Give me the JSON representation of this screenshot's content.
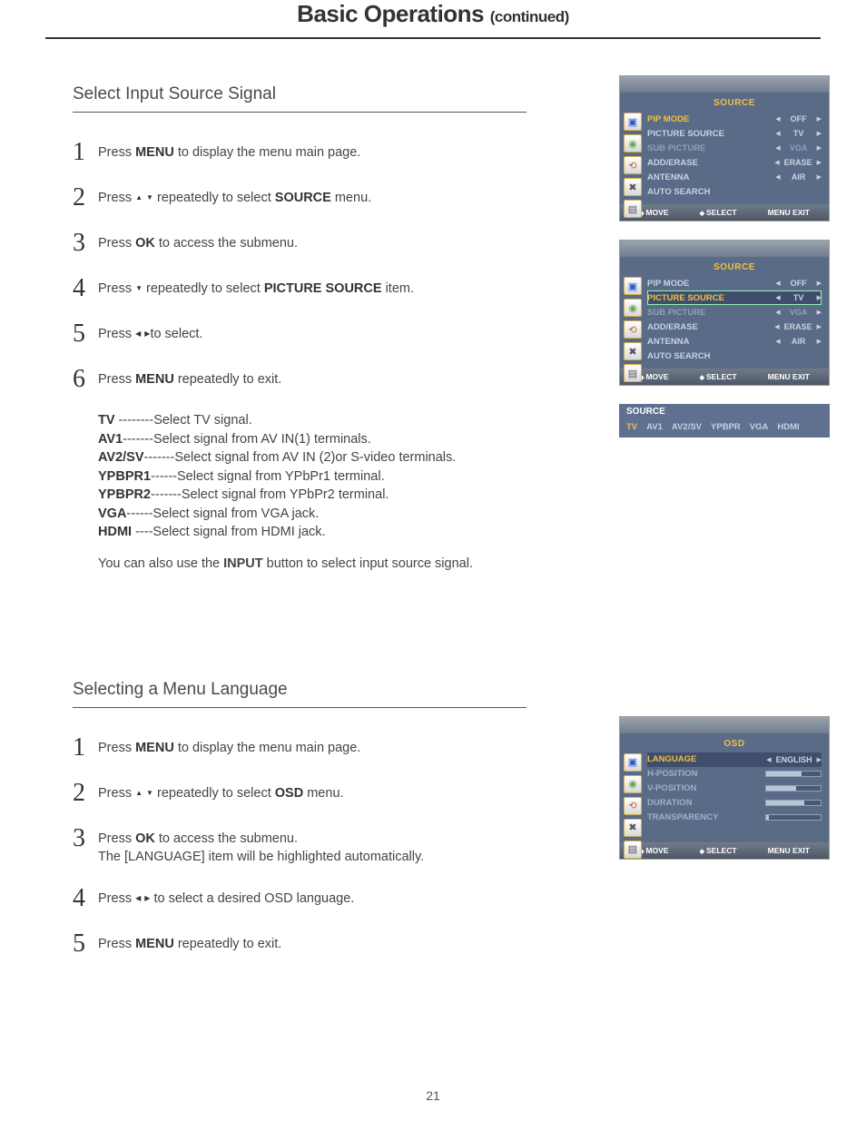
{
  "page_title": "Basic Operations",
  "page_title_cont": "(continued)",
  "page_number": "21",
  "section1": {
    "title": "Select Input Source Signal",
    "steps": [
      {
        "n": "1",
        "pre": "Press ",
        "b": "MENU",
        "post": " to display the menu main page."
      },
      {
        "n": "2",
        "pre": "Press ",
        "arrows": "ud",
        "mid": " repeatedly to select ",
        "b": "SOURCE",
        "post": " menu."
      },
      {
        "n": "3",
        "pre": "Press ",
        "b": "OK",
        "post": " to access the submenu."
      },
      {
        "n": "4",
        "pre": "Press ",
        "arrows": "d",
        "mid": " repeatedly to select ",
        "b": "PICTURE SOURCE",
        "post": " item."
      },
      {
        "n": "5",
        "pre": "Press ",
        "arrows": "lr",
        "post": "to select."
      },
      {
        "n": "6",
        "pre": "Press ",
        "b": "MENU",
        "post": " repeatedly to exit."
      }
    ],
    "signals": [
      {
        "key": "TV",
        "dash": " --------",
        "desc": "Select TV signal."
      },
      {
        "key": "AV1",
        "dash": "-------",
        "desc": "Select signal from AV IN(1) terminals."
      },
      {
        "key": "AV2/SV",
        "dash": "-------",
        "desc": "Select signal from AV IN (2)or S-video terminals."
      },
      {
        "key": "YPBPR1",
        "dash": "------",
        "desc": "Select signal from YPbPr1 terminal."
      },
      {
        "key": "YPBPR2",
        "dash": "-------",
        "desc": "Select signal from YPbPr2 terminal."
      },
      {
        "key": "VGA",
        "dash": "------",
        "desc": "Select signal from VGA jack."
      },
      {
        "key": "HDMI",
        "dash": " ----",
        "desc": "Select signal from HDMI jack."
      }
    ],
    "final_note_pre": "You can also use the ",
    "final_note_b": "INPUT",
    "final_note_post": " button to select input source signal."
  },
  "osd1": {
    "title": "SOURCE",
    "rows": [
      {
        "label": "PIP MODE",
        "val": "OFF",
        "hl": true
      },
      {
        "label": "PICTURE SOURCE",
        "val": "TV"
      },
      {
        "label": "SUB PICTURE",
        "val": "VGA",
        "dim": true
      },
      {
        "label": "ADD/ERASE",
        "val": "ERASE"
      },
      {
        "label": "ANTENNA",
        "val": "AIR"
      },
      {
        "label": "AUTO SEARCH",
        "val": ""
      }
    ],
    "footer": {
      "move": "MOVE",
      "select": "SELECT",
      "exit": "MENU  EXIT"
    }
  },
  "osd2": {
    "title": "SOURCE",
    "rows": [
      {
        "label": "PIP MODE",
        "val": "OFF"
      },
      {
        "label": "PICTURE SOURCE",
        "val": "TV",
        "sel": true
      },
      {
        "label": "SUB PICTURE",
        "val": "VGA",
        "dim": true
      },
      {
        "label": "ADD/ERASE",
        "val": "ERASE"
      },
      {
        "label": "ANTENNA",
        "val": "AIR"
      },
      {
        "label": "AUTO SEARCH",
        "val": ""
      }
    ],
    "footer": {
      "move": "MOVE",
      "select": "SELECT",
      "exit": "MENU  EXIT"
    }
  },
  "source_bar": {
    "title": "SOURCE",
    "items": [
      "TV",
      "AV1",
      "AV2/SV",
      "YPBPR",
      "VGA",
      "HDMI"
    ]
  },
  "section2": {
    "title": "Selecting a Menu Language",
    "steps": [
      {
        "n": "1",
        "pre": "Press ",
        "b": "MENU",
        "post": " to display the menu main page."
      },
      {
        "n": "2",
        "pre": "Press ",
        "arrows": "ud",
        "mid": " repeatedly to select ",
        "b": "OSD",
        "post": " menu."
      },
      {
        "n": "3",
        "pre": "Press ",
        "b": "OK",
        "post": " to access the submenu.",
        "line2": "The [LANGUAGE] item will be highlighted automatically."
      },
      {
        "n": "4",
        "pre": "Press ",
        "arrows": "lr",
        "post": " to select a desired OSD language."
      },
      {
        "n": "5",
        "pre": "Press ",
        "b": "MENU",
        "post": " repeatedly to exit."
      }
    ]
  },
  "osd3": {
    "title": "OSD",
    "rows": [
      {
        "label": "LANGUAGE",
        "val": "ENGLISH",
        "hl": true,
        "type": "lr"
      },
      {
        "label": "H-POSITION",
        "type": "slider",
        "fill": 65
      },
      {
        "label": "V-POSITION",
        "type": "slider",
        "fill": 55
      },
      {
        "label": "DURATION",
        "type": "slider",
        "fill": 70
      },
      {
        "label": "TRANSPARENCY",
        "type": "slider",
        "fill": 5
      }
    ],
    "footer": {
      "move": "MOVE",
      "select": "SELECT",
      "exit": "MENU  EXIT"
    }
  }
}
